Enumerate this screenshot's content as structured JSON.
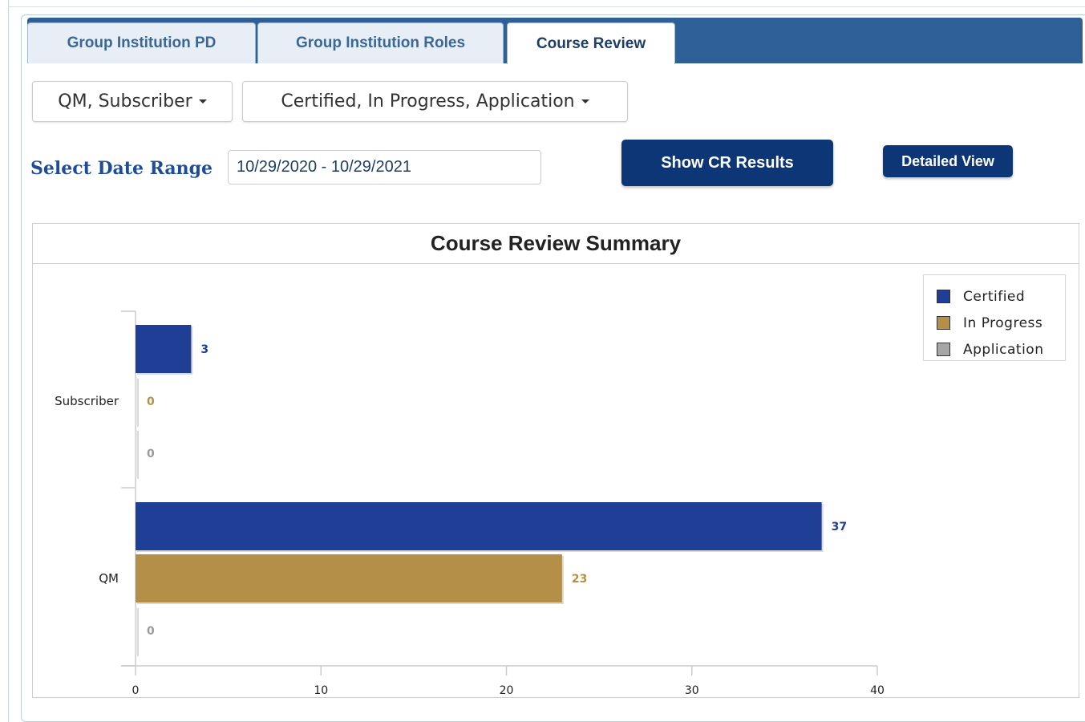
{
  "tabs": [
    {
      "label": "Group Institution PD",
      "active": false
    },
    {
      "label": "Group Institution Roles",
      "active": false
    },
    {
      "label": "Course Review",
      "active": true
    }
  ],
  "filters": {
    "roles_label": "QM, Subscriber",
    "status_label": "Certified, In Progress, Application"
  },
  "date_range": {
    "label": "Select Date Range",
    "value": "10/29/2020 - 10/29/2021"
  },
  "buttons": {
    "show_results": "Show CR Results",
    "detailed_view": "Detailed View"
  },
  "chart_data": {
    "type": "bar",
    "orientation": "horizontal",
    "title": "Course Review Summary",
    "categories": [
      "Subscriber",
      "QM"
    ],
    "series": [
      {
        "name": "Certified",
        "color": "#1f3f96",
        "values": [
          3,
          37
        ]
      },
      {
        "name": "In Progress",
        "color": "#b38f47",
        "values": [
          0,
          23
        ]
      },
      {
        "name": "Application",
        "color": "#a6a6a6",
        "values": [
          0,
          0
        ]
      }
    ],
    "xlim": [
      0,
      40
    ],
    "xticks": [
      "0",
      "10",
      "20",
      "30",
      "40"
    ],
    "grid": false,
    "legend_position": "top-right",
    "label_colors": [
      "#1f3f96",
      "#b38f47",
      "#9a9a9a"
    ]
  }
}
